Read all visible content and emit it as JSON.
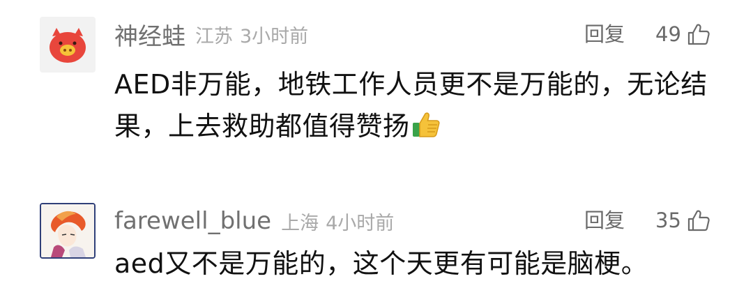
{
  "comments": [
    {
      "username": "神经蛙",
      "location": "江苏",
      "time": "3小时前",
      "reply_label": "回复",
      "likes": "49",
      "text": "AED非万能，地铁工作人员更不是万能的，无论结果，上去救助都值得赞扬",
      "emoji": "thumbs-up-emoji",
      "avatar": "pig-face-avatar"
    },
    {
      "username": "farewell_blue",
      "location": "上海",
      "time": "4小时前",
      "reply_label": "回复",
      "likes": "35",
      "text": "aed又不是万能的，这个天更有可能是脑梗。",
      "avatar": "anime-character-avatar"
    }
  ],
  "colors": {
    "username": "#707070",
    "meta": "#a9a9a9",
    "text": "#111111",
    "action": "#6a6a6a"
  }
}
